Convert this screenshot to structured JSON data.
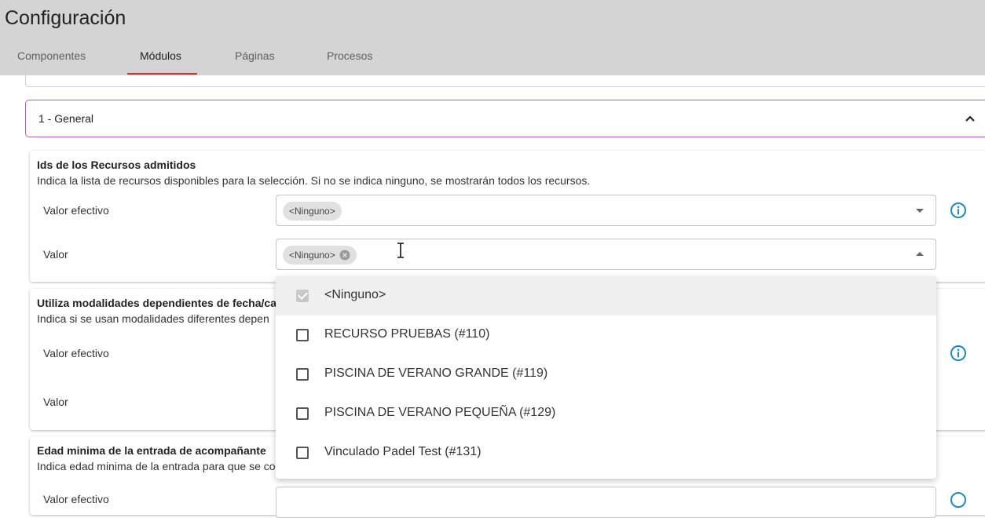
{
  "header": {
    "title": "Configuración",
    "tabs": [
      {
        "label": "Componentes"
      },
      {
        "label": "Módulos"
      },
      {
        "label": "Páginas"
      },
      {
        "label": "Procesos"
      }
    ],
    "active_tab": "Módulos"
  },
  "section": {
    "title": "1 - General"
  },
  "cards": [
    {
      "title": "Ids de los Recursos admitidos",
      "description": "Indica la lista de recursos disponibles para la selección. Si no se indica ninguno, se mostrarán todos los recursos.",
      "effective_label": "Valor efectivo",
      "effective_chip": "<Ninguno>",
      "value_label": "Valor",
      "value_chip": "<Ninguno>"
    },
    {
      "title": "Utiliza modalidades dependientes de fecha/cale",
      "description": "Indica si se usan modalidades diferentes depen",
      "effective_label": "Valor efectivo",
      "value_label": "Valor"
    },
    {
      "title": "Edad minima de la entrada de acompañante",
      "description": "Indica edad minima de la entrada para que se co",
      "effective_label": "Valor efectivo"
    }
  ],
  "dropdown": {
    "options": [
      {
        "label": "<Ninguno>",
        "checked": true
      },
      {
        "label": "RECURSO PRUEBAS (#110)",
        "checked": false
      },
      {
        "label": "PISCINA DE VERANO GRANDE (#119)",
        "checked": false
      },
      {
        "label": "PISCINA DE VERANO PEQUEÑA (#129)",
        "checked": false
      },
      {
        "label": "Vinculado Padel Test (#131)",
        "checked": false
      }
    ]
  },
  "colors": {
    "tab_underline": "#d32f2f",
    "section_border": "#b05ec8",
    "info_icon": "#1e88c8",
    "header_bg": "#d4d4d4"
  }
}
